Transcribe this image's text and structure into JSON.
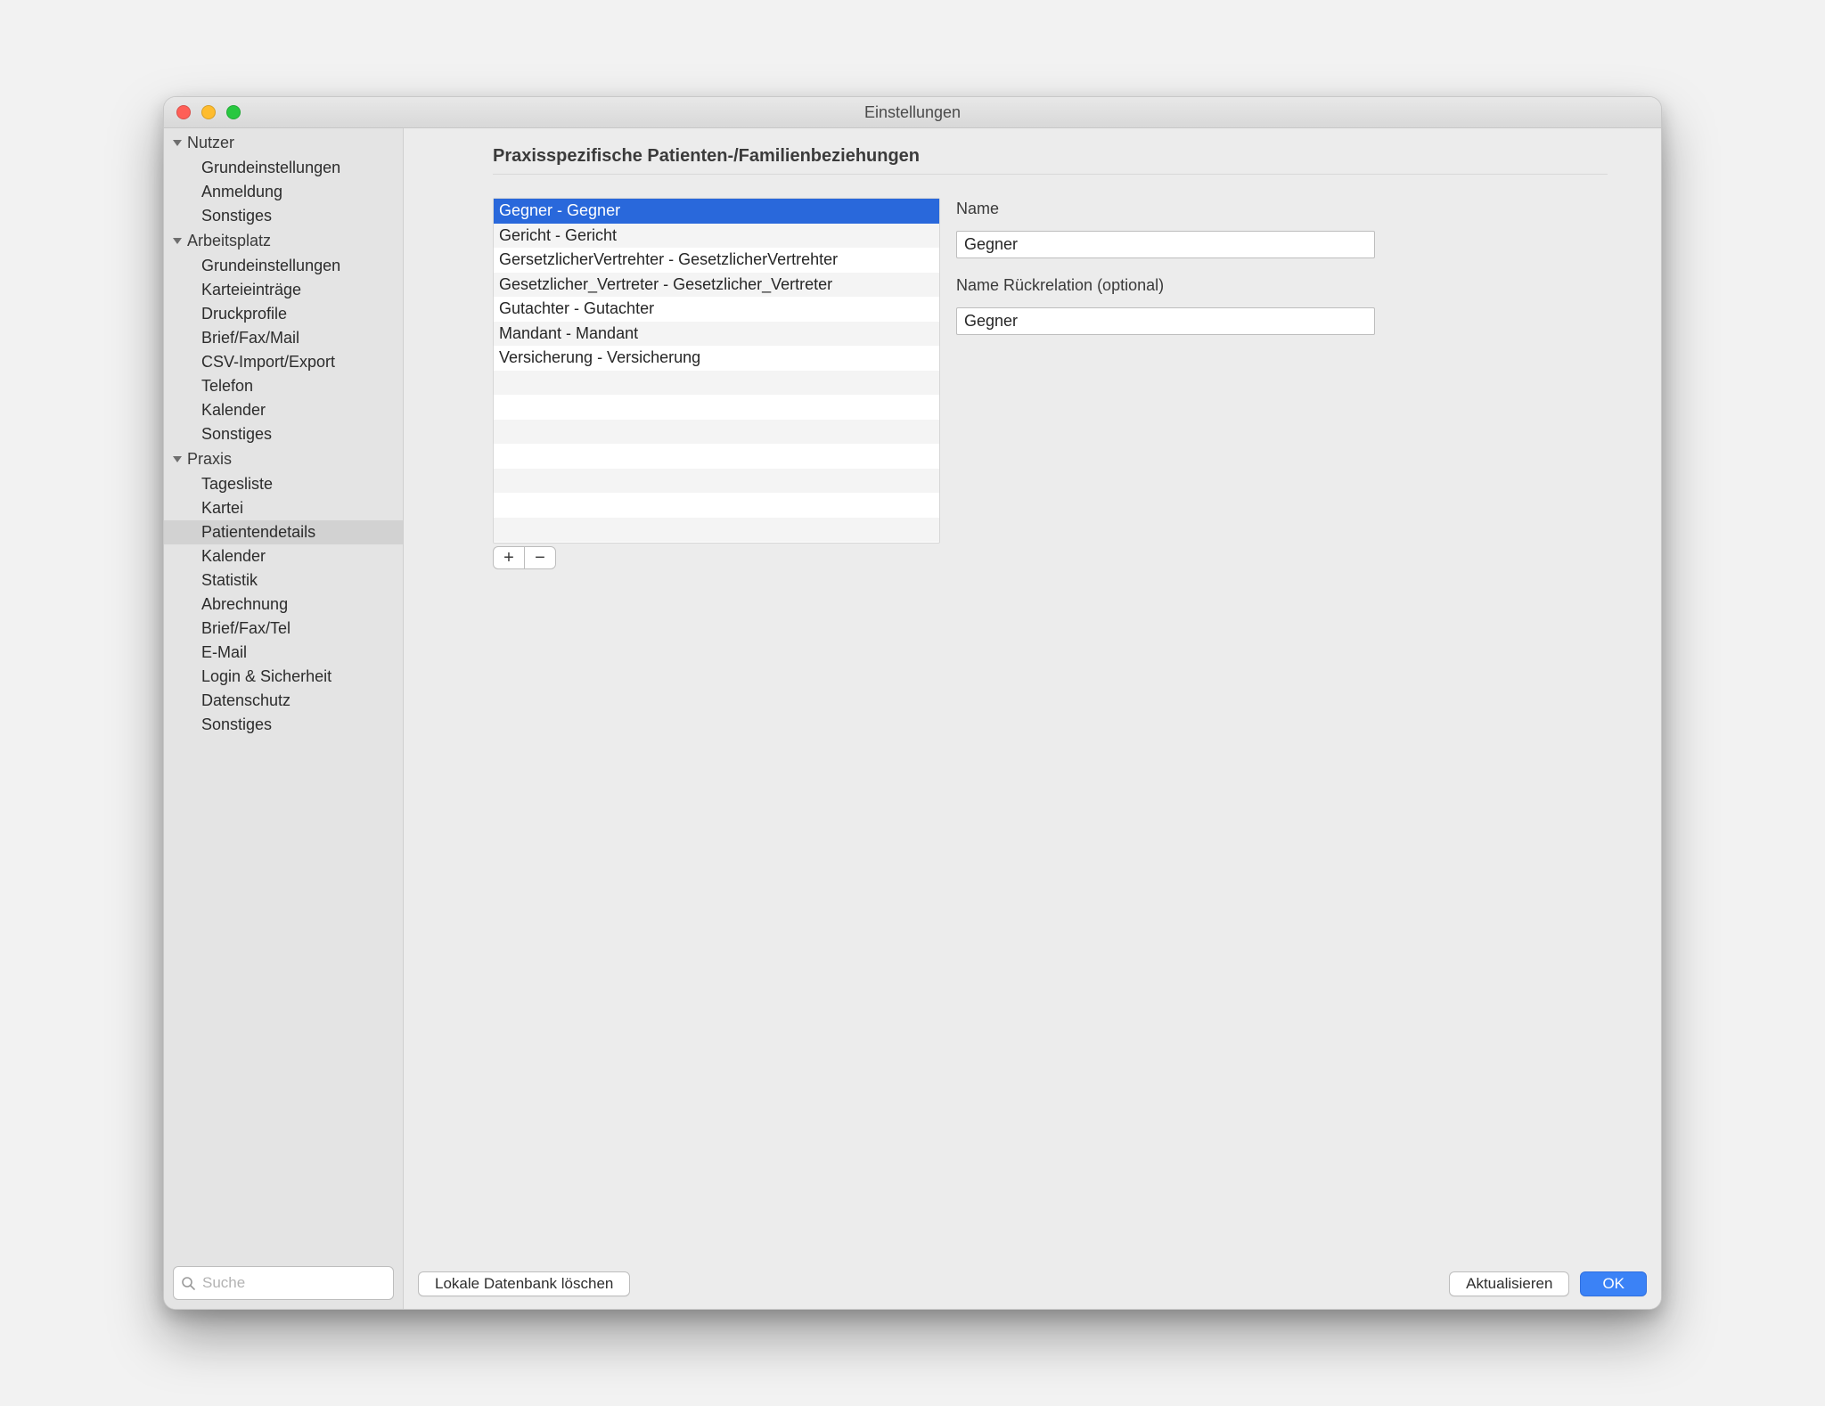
{
  "window": {
    "title": "Einstellungen"
  },
  "sidebar": {
    "sections": [
      {
        "label": "Nutzer",
        "items": [
          {
            "label": "Grundeinstellungen"
          },
          {
            "label": "Anmeldung"
          },
          {
            "label": "Sonstiges"
          }
        ]
      },
      {
        "label": "Arbeitsplatz",
        "items": [
          {
            "label": "Grundeinstellungen"
          },
          {
            "label": "Karteieinträge"
          },
          {
            "label": "Druckprofile"
          },
          {
            "label": "Brief/Fax/Mail"
          },
          {
            "label": "CSV-Import/Export"
          },
          {
            "label": "Telefon"
          },
          {
            "label": "Kalender"
          },
          {
            "label": "Sonstiges"
          }
        ]
      },
      {
        "label": "Praxis",
        "items": [
          {
            "label": "Tagesliste"
          },
          {
            "label": "Kartei"
          },
          {
            "label": "Patientendetails",
            "active": true
          },
          {
            "label": "Kalender"
          },
          {
            "label": "Statistik"
          },
          {
            "label": "Abrechnung"
          },
          {
            "label": "Brief/Fax/Tel"
          },
          {
            "label": "E-Mail"
          },
          {
            "label": "Login & Sicherheit"
          },
          {
            "label": "Datenschutz"
          },
          {
            "label": "Sonstiges"
          }
        ]
      }
    ],
    "search_placeholder": "Suche"
  },
  "page": {
    "heading": "Praxisspezifische Patienten-/Familienbeziehungen",
    "relations": [
      {
        "label": "Gegner - Gegner",
        "selected": true
      },
      {
        "label": "Gericht - Gericht"
      },
      {
        "label": "GersetzlicherVertrehter - GesetzlicherVertrehter"
      },
      {
        "label": "Gesetzlicher_Vertreter - Gesetzlicher_Vertreter"
      },
      {
        "label": "Gutachter - Gutachter"
      },
      {
        "label": "Mandant - Mandant"
      },
      {
        "label": "Versicherung - Versicherung"
      }
    ],
    "total_visible_rows": 14,
    "add_icon": "+",
    "remove_icon": "−",
    "name_label": "Name",
    "name_value": "Gegner",
    "back_label": "Name Rückrelation (optional)",
    "back_value": "Gegner"
  },
  "footer": {
    "delete_db": "Lokale Datenbank löschen",
    "refresh": "Aktualisieren",
    "ok": "OK"
  }
}
